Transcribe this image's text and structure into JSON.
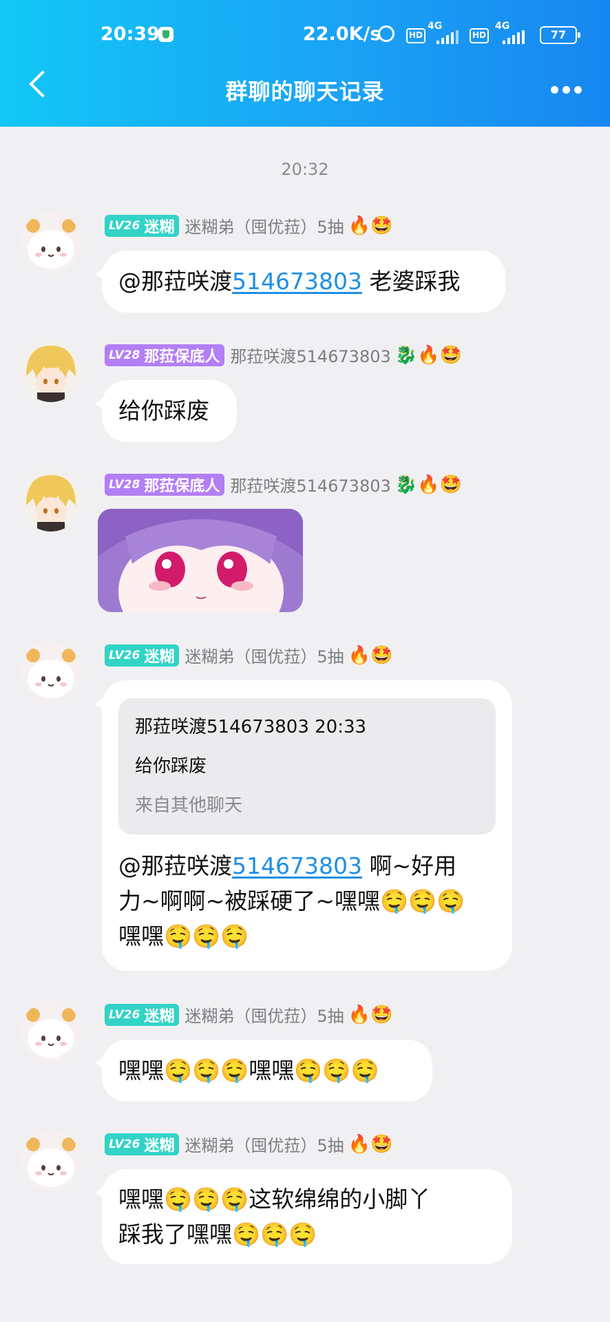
{
  "status_bar": {
    "time": "20:39",
    "speed": "22.0K/s",
    "hd": "HD",
    "net": "4G",
    "battery": "77"
  },
  "header": {
    "title": "群聊的聊天记录"
  },
  "timestamp": "20:32",
  "messages": [
    {
      "level": "LV26",
      "title": "迷糊",
      "nick": "迷糊弟（囤优菈）5抽",
      "emojis": "🔥🤩",
      "mention": "@那菈咲渡",
      "mention_id": "514673803",
      "text": " 老婆踩我"
    },
    {
      "level": "LV28",
      "title": "那菈保底人",
      "nick": "那菈咲渡514673803",
      "emojis": "🐉🔥🤩",
      "text": "给你踩废"
    },
    {
      "level": "LV28",
      "title": "那菈保底人",
      "nick": "那菈咲渡514673803",
      "emojis": "🐉🔥🤩",
      "sticker": "anime-girl-sticker"
    },
    {
      "level": "LV26",
      "title": "迷糊",
      "nick": "迷糊弟（囤优菈）5抽",
      "emojis": "🔥🤩",
      "quote": {
        "header": "那菈咲渡514673803 20:33",
        "text": "给你踩废",
        "source": "来自其他聊天"
      },
      "mention": "@那菈咲渡",
      "mention_id": "514673803",
      "line1_rest": " 啊~好用",
      "line2": "力~啊啊~被踩硬了~嘿嘿🤤🤤🤤",
      "line3": "嘿嘿🤤🤤🤤"
    },
    {
      "level": "LV26",
      "title": "迷糊",
      "nick": "迷糊弟（囤优菈）5抽",
      "emojis": "🔥🤩",
      "text": "嘿嘿🤤🤤🤤嘿嘿🤤🤤🤤"
    },
    {
      "level": "LV26",
      "title": "迷糊",
      "nick": "迷糊弟（囤优菈）5抽",
      "emojis": "🔥🤩",
      "line1": "嘿嘿🤤🤤🤤这软绵绵的小脚丫",
      "line2": "踩我了嘿嘿🤤🤤🤤"
    }
  ]
}
